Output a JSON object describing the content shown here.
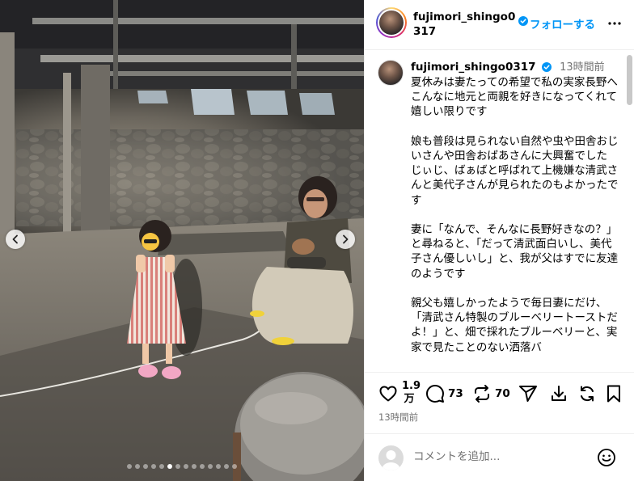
{
  "post": {
    "username": "fujimori_shingo0317",
    "follow_label": "フォローする",
    "time_ago": "13時間前",
    "caption": "夏休みは妻たっての希望で私の実家長野へ\nこんなに地元と両親を好きになってくれて嬉しい限りです\n\n娘も普段は見られない自然や虫や田舎おじいさんや田舎おばあさんに大興奮でした\nじぃじ、ばぁばと呼ばれて上機嫌な清武さんと美代子さんが見られたのもよかったです\n\n妻に「なんで、そんなに長野好きなの？」と尋ねると、「だって清武面白いし、美代子さん優しいし」と、我が父はすでに友達のようです\n\n親父も嬉しかったようで毎日妻にだけ、「清武さん特製のブルーベリートーストだよ！」と、畑で採れたブルーベリーと、実家で見たことのない洒落バ"
  },
  "actions": {
    "like_count": "1.9万",
    "like_count_top": "1.9",
    "like_count_bottom": "万",
    "comment_count": "73",
    "repost_count": "70",
    "timestamp": "13時間前"
  },
  "comment_input": {
    "placeholder": "コメントを追加..."
  },
  "carousel": {
    "total_slides": 14,
    "active_index": 5
  },
  "colors": {
    "accent": "#0095f6",
    "verified": "#0095f6",
    "secondary_text": "#737373",
    "divider": "#efefef"
  },
  "icons": [
    "heart-icon",
    "comment-icon",
    "repost-icon",
    "share-icon",
    "download-icon",
    "refresh-icon",
    "save-icon",
    "more-icon",
    "emoji-icon",
    "chevron-left-icon",
    "chevron-right-icon"
  ]
}
